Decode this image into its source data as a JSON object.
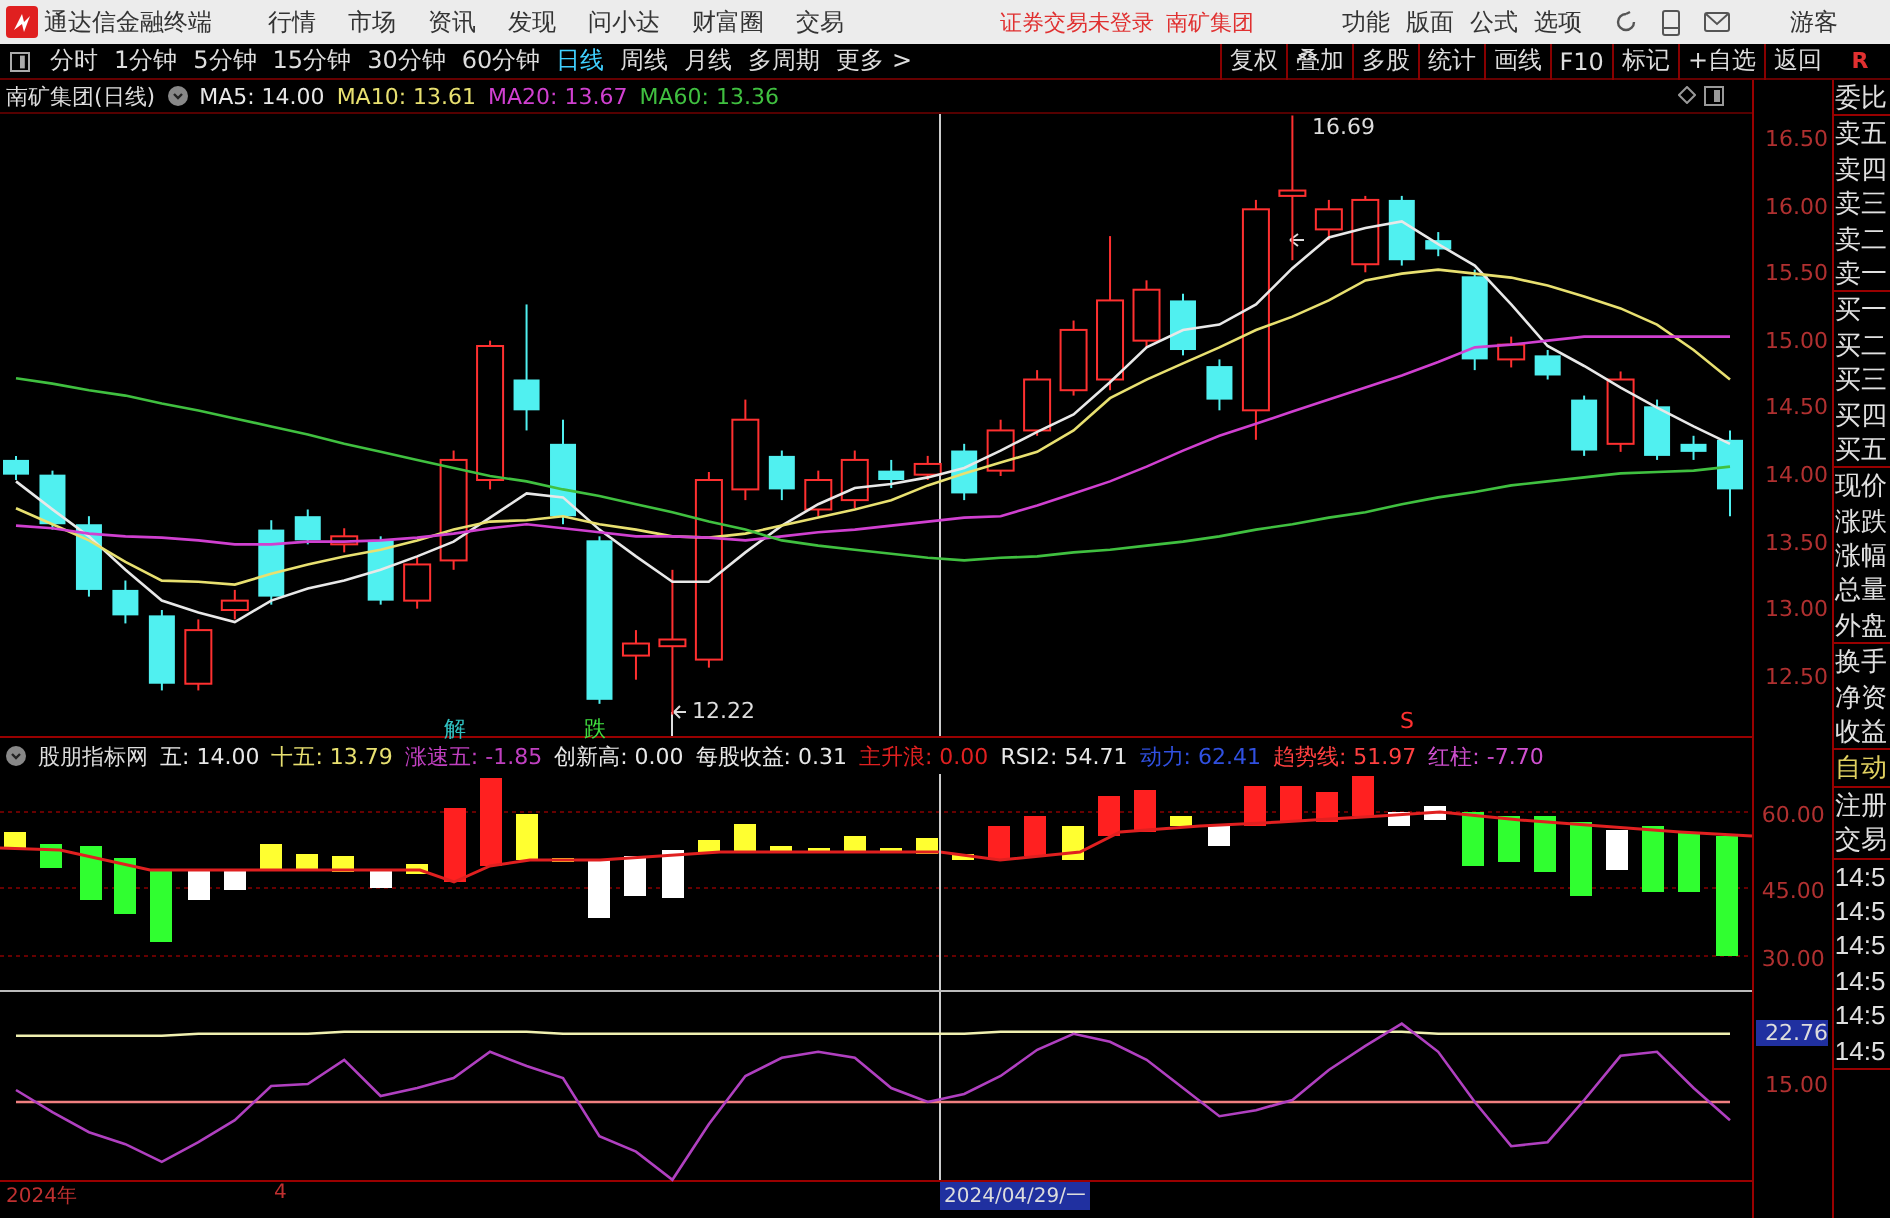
{
  "title_bar": {
    "app_title": "通达信金融终端",
    "menu": [
      "行情",
      "市场",
      "资讯",
      "发现",
      "问小达",
      "财富圈",
      "交易"
    ],
    "login_status": "证券交易未登录",
    "stock_name": "南矿集团",
    "right_menu": [
      "功能",
      "版面",
      "公式",
      "选项"
    ],
    "user": "游客"
  },
  "period_tabs": [
    {
      "label": "分时",
      "selected": false
    },
    {
      "label": "1分钟",
      "selected": false
    },
    {
      "label": "5分钟",
      "selected": false
    },
    {
      "label": "15分钟",
      "selected": false
    },
    {
      "label": "30分钟",
      "selected": false
    },
    {
      "label": "60分钟",
      "selected": false
    },
    {
      "label": "日线",
      "selected": true
    },
    {
      "label": "周线",
      "selected": false
    },
    {
      "label": "月线",
      "selected": false
    },
    {
      "label": "多周期",
      "selected": false
    },
    {
      "label": "更多 >",
      "selected": false
    }
  ],
  "tool_buttons": [
    "复权",
    "叠加",
    "多股",
    "统计",
    "画线",
    "F10",
    "标记",
    "+自选",
    "返回"
  ],
  "corner_label": "R",
  "price_chart": {
    "title": "南矿集团(日线)",
    "averages": [
      ": 14.00",
      ": 13.61",
      ": 13.67",
      ": 13.36"
    ],
    "chart_data": {
      "type": "candlestick",
      "ylim": [
        12.045,
        16.716
      ],
      "ohlc": [
        [
          14.12,
          14.15,
          13.97,
          14.01
        ],
        [
          14.01,
          14.04,
          13.6,
          13.64
        ],
        [
          13.64,
          13.7,
          13.1,
          13.15
        ],
        [
          13.15,
          13.22,
          12.9,
          12.96
        ],
        [
          12.96,
          13.0,
          12.4,
          12.45
        ],
        [
          12.45,
          12.93,
          12.4,
          12.85
        ],
        [
          13.0,
          13.15,
          12.93,
          13.07
        ],
        [
          13.6,
          13.67,
          13.04,
          13.1
        ],
        [
          13.7,
          13.75,
          13.49,
          13.52
        ],
        [
          13.49,
          13.61,
          13.43,
          13.55
        ],
        [
          13.52,
          13.55,
          13.04,
          13.07
        ],
        [
          13.07,
          13.4,
          13.01,
          13.34
        ],
        [
          13.37,
          14.19,
          13.3,
          14.12
        ],
        [
          13.97,
          15.01,
          13.9,
          14.97
        ],
        [
          14.72,
          15.28,
          14.34,
          14.49
        ],
        [
          14.24,
          14.42,
          13.64,
          13.7
        ],
        [
          13.52,
          13.55,
          12.3,
          12.33
        ],
        [
          12.66,
          12.85,
          12.48,
          12.75
        ],
        [
          12.73,
          13.3,
          12.22,
          12.78
        ],
        [
          12.63,
          14.03,
          12.57,
          13.97
        ],
        [
          13.9,
          14.57,
          13.82,
          14.42
        ],
        [
          14.15,
          14.19,
          13.82,
          13.9
        ],
        [
          13.75,
          14.04,
          13.7,
          13.97
        ],
        [
          13.82,
          14.19,
          13.76,
          14.12
        ],
        [
          14.04,
          14.12,
          13.91,
          13.97
        ],
        [
          14.01,
          14.15,
          13.97,
          14.09
        ],
        [
          14.19,
          14.24,
          13.82,
          13.87
        ],
        [
          14.04,
          14.42,
          14.0,
          14.34
        ],
        [
          14.34,
          14.79,
          14.3,
          14.72
        ],
        [
          14.64,
          15.16,
          14.6,
          15.09
        ],
        [
          14.72,
          15.79,
          14.64,
          15.31
        ],
        [
          15.01,
          15.46,
          14.96,
          15.39
        ],
        [
          15.31,
          15.36,
          14.9,
          14.94
        ],
        [
          14.82,
          14.87,
          14.49,
          14.57
        ],
        [
          14.49,
          16.06,
          14.27,
          15.99
        ],
        [
          16.09,
          16.69,
          15.61,
          16.13
        ],
        [
          15.84,
          16.06,
          15.76,
          15.99
        ],
        [
          15.58,
          16.09,
          15.52,
          16.06
        ],
        [
          16.06,
          16.09,
          15.57,
          15.61
        ],
        [
          15.76,
          15.82,
          15.64,
          15.69
        ],
        [
          15.49,
          15.54,
          14.79,
          14.87
        ],
        [
          14.87,
          15.04,
          14.81,
          14.98
        ],
        [
          14.9,
          14.94,
          14.72,
          14.75
        ],
        [
          14.57,
          14.6,
          14.15,
          14.19
        ],
        [
          14.24,
          14.78,
          14.18,
          14.72
        ],
        [
          14.52,
          14.57,
          14.12,
          14.15
        ],
        [
          14.24,
          14.3,
          14.12,
          14.18
        ],
        [
          14.27,
          14.34,
          13.7,
          13.9
        ]
      ],
      "yticks": [
        {
          "value": 16.5,
          "label": "16.50"
        },
        {
          "value": 16,
          "label": "16.00"
        },
        {
          "value": 15.5,
          "label": "15.50"
        },
        {
          "value": 15,
          "label": "15.00"
        },
        {
          "value": 14.5,
          "label": "14.50"
        },
        {
          "value": 14,
          "label": "14.00"
        },
        {
          "value": 13.5,
          "label": "13.50"
        },
        {
          "value": 13,
          "label": "13.00"
        },
        {
          "value": 12.5,
          "label": "12.50"
        }
      ],
      "series": [
        {
          "name": "MA5",
          "type": "line",
          "color": "#e8e8e8",
          "values": [
            13.96,
            13.75,
            13.55,
            13.3,
            13.07,
            12.98,
            12.91,
            13.07,
            13.16,
            13.22,
            13.3,
            13.4,
            13.51,
            13.69,
            13.87,
            13.84,
            13.6,
            13.4,
            13.21,
            13.21,
            13.43,
            13.63,
            13.79,
            13.91,
            13.94,
            13.99,
            14.06,
            14.19,
            14.33,
            14.46,
            14.7,
            14.96,
            15.09,
            15.13,
            15.28,
            15.55,
            15.78,
            15.85,
            15.9,
            15.73,
            15.57,
            15.28,
            14.97,
            14.82,
            14.66,
            14.51,
            14.37,
            14.24
          ]
        },
        {
          "name": "MA10",
          "type": "line",
          "color": "#e8e070",
          "values": [
            13.76,
            13.64,
            13.52,
            13.36,
            13.22,
            13.21,
            13.19,
            13.27,
            13.34,
            13.4,
            13.45,
            13.52,
            13.6,
            13.66,
            13.67,
            13.7,
            13.64,
            13.6,
            13.55,
            13.54,
            13.57,
            13.63,
            13.69,
            13.75,
            13.82,
            13.93,
            14.02,
            14.1,
            14.18,
            14.34,
            14.58,
            14.72,
            14.84,
            14.96,
            15.09,
            15.19,
            15.31,
            15.46,
            15.51,
            15.54,
            15.51,
            15.48,
            15.42,
            15.34,
            15.25,
            15.13,
            14.94,
            14.72
          ]
        },
        {
          "name": "MA20",
          "type": "line",
          "color": "#d040d0",
          "values": [
            13.63,
            13.61,
            13.57,
            13.55,
            13.54,
            13.52,
            13.49,
            13.49,
            13.51,
            13.51,
            13.52,
            13.54,
            13.57,
            13.61,
            13.64,
            13.61,
            13.58,
            13.55,
            13.55,
            13.54,
            13.52,
            13.55,
            13.58,
            13.6,
            13.63,
            13.66,
            13.69,
            13.7,
            13.78,
            13.87,
            13.96,
            14.07,
            14.19,
            14.3,
            14.39,
            14.48,
            14.57,
            14.66,
            14.75,
            14.85,
            14.96,
            14.98,
            15.01,
            15.04,
            15.04,
            15.04,
            15.04,
            15.04
          ]
        },
        {
          "name": "MA60",
          "type": "line",
          "color": "#40c040",
          "values": [
            14.73,
            14.69,
            14.64,
            14.6,
            14.54,
            14.49,
            14.43,
            14.37,
            14.31,
            14.24,
            14.18,
            14.12,
            14.06,
            14.0,
            13.96,
            13.9,
            13.85,
            13.79,
            13.73,
            13.66,
            13.6,
            13.52,
            13.48,
            13.45,
            13.42,
            13.39,
            13.37,
            13.39,
            13.4,
            13.43,
            13.45,
            13.48,
            13.51,
            13.55,
            13.6,
            13.64,
            13.69,
            13.73,
            13.79,
            13.84,
            13.88,
            13.93,
            13.96,
            13.99,
            14.02,
            14.03,
            14.04,
            14.07
          ]
        }
      ]
    },
    "high_label": "16.69",
    "low_label": "12.22",
    "signals": [
      {
        "text": "解",
        "color": "#30c0c0"
      },
      {
        "text": "跌",
        "color": "#40e040"
      },
      {
        "text": "S",
        "color": "#ff3030"
      }
    ]
  },
  "indicator": {
    "name": "股朋指标网",
    "values": [
      {
        "label": "五: 14.00",
        "color": "#e8e8e8"
      },
      {
        "label": "十五: 13.79",
        "color": "#e8e070"
      },
      {
        "label": "涨速五: -1.85",
        "color": "#c040c0"
      },
      {
        "label": "创新高: 0.00",
        "color": "#e8e8e8"
      },
      {
        "label": "每股收益: 0.31",
        "color": "#e8e8e8"
      },
      {
        "label": "主升浪: 0.00",
        "color": "#e02020"
      },
      {
        "label": "RSI2: 54.71",
        "color": "#e8e8e8"
      },
      {
        "label": "动力: 62.41",
        "color": "#3050e0"
      },
      {
        "label": "趋势线: 51.97",
        "color": "#ff4040"
      },
      {
        "label": "红柱: -7.70",
        "color": "#d050d0"
      }
    ],
    "axis_labels": [
      "60.00",
      "45.00",
      "30.00"
    ]
  },
  "rsi_panel": {
    "chart_data": {
      "type": "line",
      "ylim": [
        0.67,
        29.33
      ],
      "yticks": [
        {
          "value": 22.76,
          "label": "22.76"
        },
        {
          "value": 15,
          "label": "15.00"
        }
      ],
      "series": [
        {
          "color": "#f0f0b0",
          "values": [
            22.5,
            22.5,
            22.5,
            22.5,
            22.5,
            22.8,
            22.8,
            22.8,
            22.8,
            23.1,
            23.1,
            23.1,
            23.1,
            23.1,
            23.1,
            22.8,
            22.8,
            22.8,
            22.8,
            22.8,
            22.8,
            22.8,
            22.8,
            22.8,
            22.8,
            22.8,
            22.8,
            23.1,
            23.1,
            23.1,
            23.1,
            23.1,
            23.1,
            23.1,
            23.1,
            23.1,
            23.1,
            23.1,
            23.1,
            22.8,
            22.8,
            22.8,
            22.8,
            22.8,
            22.8,
            22.8,
            22.8,
            22.8
          ]
        },
        {
          "color": "#f08080",
          "values": [
            12.6,
            12.6,
            12.6,
            12.6,
            12.6,
            12.6,
            12.6,
            12.6,
            12.6,
            12.6,
            12.6,
            12.6,
            12.6,
            12.6,
            12.6,
            12.6,
            12.6,
            12.6,
            12.6,
            12.6,
            12.6,
            12.6,
            12.6,
            12.6,
            12.6,
            12.6,
            12.6,
            12.6,
            12.6,
            12.6,
            12.6,
            12.6,
            12.6,
            12.6,
            12.6,
            12.6,
            12.6,
            12.6,
            12.6,
            12.6,
            12.6,
            12.6,
            12.6,
            12.6,
            12.6,
            12.6,
            12.6,
            12.6
          ]
        },
        {
          "color": "#b040c0",
          "values": [
            14.4,
            11.1,
            8.1,
            6.3,
            3.7,
            6.6,
            9.9,
            15.0,
            15.3,
            18.9,
            13.5,
            14.7,
            16.2,
            20.1,
            18.0,
            16.2,
            7.5,
            5.2,
            1.0,
            9.3,
            16.5,
            19.2,
            20.1,
            19.2,
            14.7,
            12.6,
            13.8,
            16.5,
            20.4,
            22.8,
            21.6,
            18.9,
            14.7,
            10.5,
            11.4,
            12.9,
            17.4,
            21.0,
            24.3,
            20.1,
            12.6,
            6.0,
            6.6,
            12.9,
            19.5,
            20.1,
            14.7,
            9.9
          ]
        }
      ]
    }
  },
  "date_axis": {
    "labels": [
      "2024年",
      "4"
    ],
    "cursor_date": "2024/04/29/一"
  },
  "quote_sidebar": {
    "groups": [
      {
        "highlighted": false,
        "items": [
          "委比"
        ]
      },
      {
        "highlighted": false,
        "items": [
          "卖五",
          "卖四",
          "卖三",
          "卖二",
          "卖一"
        ]
      },
      {
        "highlighted": false,
        "items": [
          "买一",
          "买二",
          "买三",
          "买四",
          "买五"
        ]
      },
      {
        "highlighted": false,
        "items": [
          "现价",
          "涨跌",
          "涨幅",
          "总量",
          "外盘"
        ]
      },
      {
        "highlighted": false,
        "items": [
          "换手",
          "净资",
          "收益"
        ]
      },
      {
        "highlighted": true,
        "items": [
          "自动"
        ]
      },
      {
        "highlighted": false,
        "items": [
          "注册",
          "交易"
        ]
      },
      {
        "highlighted": false,
        "items": [
          "14:5",
          "14:5",
          "14:5",
          "14:5",
          "14:5",
          "14:5"
        ]
      }
    ]
  }
}
